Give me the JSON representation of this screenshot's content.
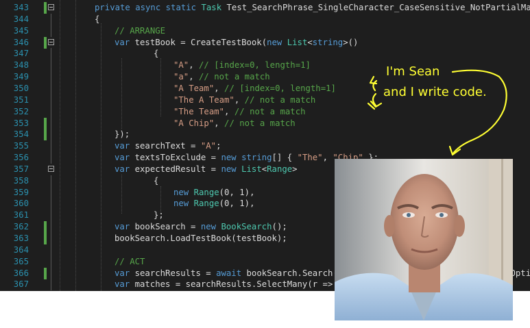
{
  "editor": {
    "lines": [
      {
        "num": "343",
        "changed": true,
        "fold": true,
        "indent": 138,
        "tokens": [
          [
            "kw",
            "private async static "
          ],
          [
            "type",
            "Task "
          ],
          [
            "pl",
            "Test_SearchPhrase_SingleCharacter_CaseSensitive_NotPartialMatch_"
          ]
        ]
      },
      {
        "num": "344",
        "changed": false,
        "fold": false,
        "indent": 138,
        "tokens": [
          [
            "pl",
            "{"
          ]
        ]
      },
      {
        "num": "345",
        "changed": false,
        "fold": false,
        "indent": 167,
        "tokens": [
          [
            "com",
            "// ARRANGE"
          ]
        ]
      },
      {
        "num": "346",
        "changed": true,
        "fold": true,
        "indent": 167,
        "tokens": [
          [
            "kw",
            "var "
          ],
          [
            "pl",
            "testBook = CreateTestBook("
          ],
          [
            "kw",
            "new "
          ],
          [
            "type",
            "List"
          ],
          [
            "pl",
            "<"
          ],
          [
            "kw",
            "string"
          ],
          [
            "pl",
            ">()"
          ]
        ]
      },
      {
        "num": "347",
        "changed": false,
        "fold": false,
        "indent": 224,
        "tokens": [
          [
            "pl",
            "{"
          ]
        ]
      },
      {
        "num": "348",
        "changed": false,
        "fold": false,
        "indent": 253,
        "tokens": [
          [
            "str",
            "\"A\""
          ],
          [
            "pl",
            ", "
          ],
          [
            "com",
            "// [index=0, length=1]"
          ]
        ]
      },
      {
        "num": "349",
        "changed": false,
        "fold": false,
        "indent": 253,
        "tokens": [
          [
            "str",
            "\"a\""
          ],
          [
            "pl",
            ", "
          ],
          [
            "com",
            "// not a match"
          ]
        ]
      },
      {
        "num": "350",
        "changed": false,
        "fold": false,
        "indent": 253,
        "tokens": [
          [
            "str",
            "\"A Team\""
          ],
          [
            "pl",
            ", "
          ],
          [
            "com",
            "// [index=0, length=1]"
          ]
        ]
      },
      {
        "num": "351",
        "changed": false,
        "fold": false,
        "indent": 253,
        "tokens": [
          [
            "str",
            "\"The A Team\""
          ],
          [
            "pl",
            ", "
          ],
          [
            "com",
            "// not a match"
          ]
        ]
      },
      {
        "num": "352",
        "changed": false,
        "fold": false,
        "indent": 253,
        "tokens": [
          [
            "str",
            "\"The Team\""
          ],
          [
            "pl",
            ", "
          ],
          [
            "com",
            "// not a match"
          ]
        ]
      },
      {
        "num": "353",
        "changed": true,
        "fold": false,
        "indent": 253,
        "tokens": [
          [
            "str",
            "\"A Chip\""
          ],
          [
            "pl",
            ", "
          ],
          [
            "com",
            "// not a match"
          ]
        ]
      },
      {
        "num": "354",
        "changed": true,
        "fold": false,
        "indent": 167,
        "tokens": [
          [
            "pl",
            "});"
          ]
        ]
      },
      {
        "num": "355",
        "changed": false,
        "fold": false,
        "indent": 167,
        "tokens": [
          [
            "kw",
            "var "
          ],
          [
            "pl",
            "searchText = "
          ],
          [
            "str",
            "\"A\""
          ],
          [
            "pl",
            ";"
          ]
        ]
      },
      {
        "num": "356",
        "changed": false,
        "fold": false,
        "indent": 167,
        "tokens": [
          [
            "kw",
            "var "
          ],
          [
            "pl",
            "textsToExclude = "
          ],
          [
            "kw",
            "new string"
          ],
          [
            "pl",
            "[] { "
          ],
          [
            "str",
            "\"The\""
          ],
          [
            "pl",
            ", "
          ],
          [
            "str",
            "\"Chip\""
          ],
          [
            "pl",
            " };"
          ]
        ]
      },
      {
        "num": "357",
        "changed": false,
        "fold": true,
        "indent": 167,
        "tokens": [
          [
            "kw",
            "var "
          ],
          [
            "pl",
            "expectedResult = "
          ],
          [
            "kw",
            "new "
          ],
          [
            "type",
            "List"
          ],
          [
            "pl",
            "<"
          ],
          [
            "type",
            "Range"
          ],
          [
            "pl",
            ">"
          ]
        ]
      },
      {
        "num": "358",
        "changed": false,
        "fold": false,
        "indent": 224,
        "tokens": [
          [
            "pl",
            "{"
          ]
        ]
      },
      {
        "num": "359",
        "changed": false,
        "fold": false,
        "indent": 253,
        "tokens": [
          [
            "kw",
            "new "
          ],
          [
            "type",
            "Range"
          ],
          [
            "pl",
            "(0, 1),"
          ]
        ]
      },
      {
        "num": "360",
        "changed": false,
        "fold": false,
        "indent": 253,
        "tokens": [
          [
            "kw",
            "new "
          ],
          [
            "type",
            "Range"
          ],
          [
            "pl",
            "(0, 1),"
          ]
        ]
      },
      {
        "num": "361",
        "changed": false,
        "fold": false,
        "indent": 224,
        "tokens": [
          [
            "pl",
            "};"
          ]
        ]
      },
      {
        "num": "362",
        "changed": true,
        "fold": false,
        "indent": 167,
        "tokens": [
          [
            "kw",
            "var "
          ],
          [
            "pl",
            "bookSearch = "
          ],
          [
            "kw",
            "new "
          ],
          [
            "type",
            "BookSearch"
          ],
          [
            "pl",
            "();"
          ]
        ]
      },
      {
        "num": "363",
        "changed": true,
        "fold": false,
        "indent": 167,
        "tokens": [
          [
            "pl",
            "bookSearch.LoadTestBook(testBook);"
          ]
        ]
      },
      {
        "num": "364",
        "changed": false,
        "fold": false,
        "indent": 167,
        "tokens": [
          [
            "pl",
            ""
          ]
        ]
      },
      {
        "num": "365",
        "changed": false,
        "fold": false,
        "indent": 167,
        "tokens": [
          [
            "com",
            "// ACT"
          ]
        ]
      },
      {
        "num": "366",
        "changed": true,
        "fold": false,
        "indent": 167,
        "tokens": [
          [
            "kw",
            "var "
          ],
          [
            "pl",
            "searchResults = "
          ],
          [
            "kw",
            "await "
          ],
          [
            "pl",
            "bookSearch.Search(searchText, textsToExclude, SearchOptions.Phr"
          ]
        ]
      },
      {
        "num": "367",
        "changed": false,
        "fold": false,
        "indent": 167,
        "tokens": [
          [
            "kw",
            "var "
          ],
          [
            "pl",
            "matches = searchResults.SelectMany(r => r.Matches);"
          ]
        ]
      }
    ]
  },
  "annotation": {
    "line1": "I'm Sean",
    "line2": "and I write code."
  },
  "photo": {
    "subject": "portrait-photo"
  },
  "colors": {
    "editor_bg": "#1e1e1e",
    "keyword": "#569cd6",
    "type": "#4ec9b0",
    "string": "#d69d85",
    "comment": "#57a64a",
    "line_number": "#2b91af",
    "annotation": "#ffff33"
  }
}
